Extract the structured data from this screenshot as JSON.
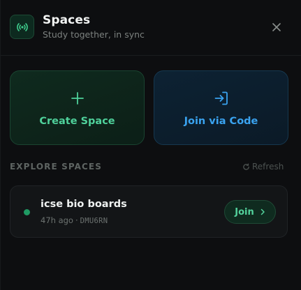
{
  "header": {
    "title": "Spaces",
    "subtitle": "Study together, in sync",
    "app_icon": "broadcast-icon",
    "close_icon": "close-icon"
  },
  "actions": {
    "create": {
      "label": "Create Space",
      "icon": "plus-icon"
    },
    "join": {
      "label": "Join via Code",
      "icon": "enter-icon"
    }
  },
  "explore": {
    "title": "EXPLORE SPACES",
    "refresh_label": "Refresh",
    "refresh_icon": "refresh-icon",
    "spaces": [
      {
        "name": "icse bio boards",
        "time_ago": "47h ago",
        "separator": "·",
        "code": "DMU6RN",
        "status": "active",
        "join_label": "Join",
        "join_icon": "chevron-right-icon"
      }
    ]
  },
  "colors": {
    "accent_green": "#4fd19b",
    "accent_blue": "#3aa3f0",
    "background": "#0d0e10",
    "status_active": "#1f9a63"
  }
}
